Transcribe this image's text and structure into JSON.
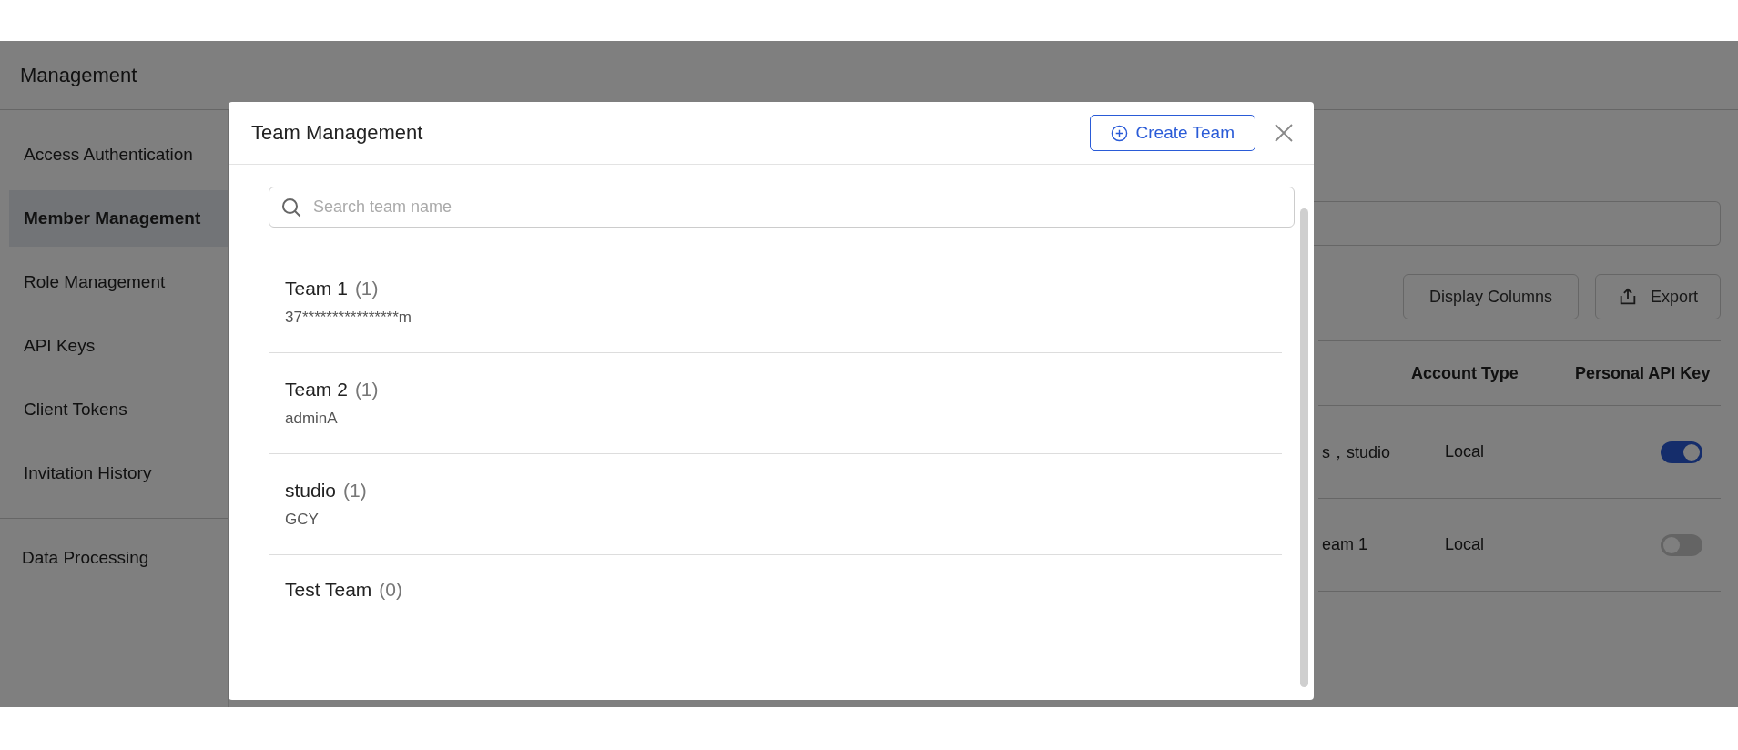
{
  "page": {
    "title": "Management",
    "sidebar": {
      "items": [
        {
          "label": "Access Authentication",
          "selected": false
        },
        {
          "label": "Member Management",
          "selected": true
        },
        {
          "label": "Role Management",
          "selected": false
        },
        {
          "label": "API Keys",
          "selected": false
        },
        {
          "label": "Client Tokens",
          "selected": false
        },
        {
          "label": "Invitation History",
          "selected": false
        }
      ],
      "footer_items": [
        {
          "label": "Data Processing",
          "selected": false
        }
      ]
    },
    "toolbar": {
      "buttons": [
        {
          "label": "Display Columns",
          "kind": "plain"
        },
        {
          "label": "Export",
          "kind": "export"
        }
      ]
    },
    "table": {
      "columns": [
        "Account Type",
        "Personal API Key"
      ],
      "rows": [
        {
          "column_1": "s，studio",
          "account_type": "Local",
          "api_key_enabled": true
        },
        {
          "column_1": "eam 1",
          "account_type": "Local",
          "api_key_enabled": false
        }
      ]
    }
  },
  "modal": {
    "title": "Team Management",
    "create_button": "Create Team",
    "search": {
      "placeholder": "Search team name"
    },
    "teams": [
      {
        "name": "Team 1",
        "count": "(1)",
        "members": "37****************m"
      },
      {
        "name": "Team 2",
        "count": "(1)",
        "members": "adminA"
      },
      {
        "name": "studio",
        "count": "(1)",
        "members": "GCY"
      },
      {
        "name": "Test Team",
        "count": "(0)"
      }
    ]
  }
}
